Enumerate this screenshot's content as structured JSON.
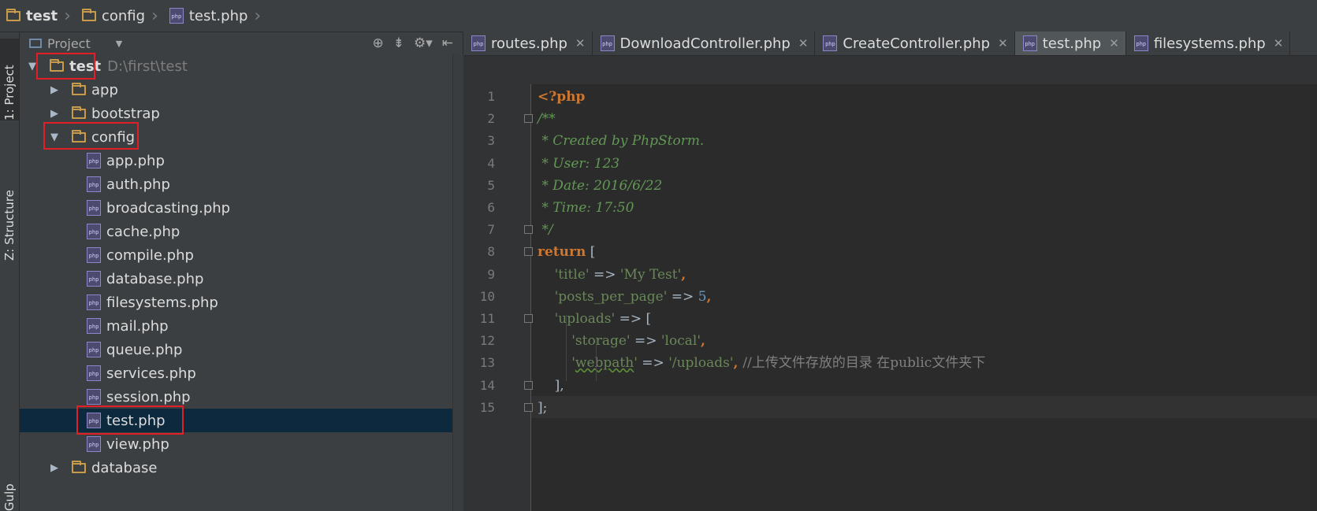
{
  "breadcrumb": [
    {
      "label": "test",
      "icon": "folder-icon"
    },
    {
      "label": "config",
      "icon": "folder-icon"
    },
    {
      "label": "test.php",
      "icon": "php-file-icon"
    }
  ],
  "tool_windows": {
    "project": "1: Project",
    "structure": "Z: Structure",
    "gulp": "Gulp"
  },
  "project_panel": {
    "title": "Project",
    "tools": [
      "⊕",
      "⇟",
      "⚙▾",
      "⇤"
    ]
  },
  "tree": [
    {
      "label": "test",
      "path": "D:\\first\\test",
      "type": "folder",
      "expanded": true
    },
    {
      "label": "app",
      "type": "folder",
      "expanded": false
    },
    {
      "label": "bootstrap",
      "type": "folder",
      "expanded": false
    },
    {
      "label": "config",
      "type": "folder",
      "expanded": true
    },
    {
      "label": "app.php",
      "type": "php"
    },
    {
      "label": "auth.php",
      "type": "php"
    },
    {
      "label": "broadcasting.php",
      "type": "php"
    },
    {
      "label": "cache.php",
      "type": "php"
    },
    {
      "label": "compile.php",
      "type": "php"
    },
    {
      "label": "database.php",
      "type": "php"
    },
    {
      "label": "filesystems.php",
      "type": "php"
    },
    {
      "label": "mail.php",
      "type": "php"
    },
    {
      "label": "queue.php",
      "type": "php"
    },
    {
      "label": "services.php",
      "type": "php"
    },
    {
      "label": "session.php",
      "type": "php"
    },
    {
      "label": "test.php",
      "type": "php",
      "selected": true
    },
    {
      "label": "view.php",
      "type": "php"
    },
    {
      "label": "database",
      "type": "folder",
      "expanded": false
    }
  ],
  "tabs": [
    {
      "label": "routes.php"
    },
    {
      "label": "DownloadController.php"
    },
    {
      "label": "CreateController.php"
    },
    {
      "label": "test.php",
      "active": true
    },
    {
      "label": "filesystems.php"
    }
  ],
  "php_icon_text": "php",
  "close_glyph": "✕",
  "editor": {
    "line_numbers": [
      "1",
      "2",
      "3",
      "4",
      "5",
      "6",
      "7",
      "8",
      "9",
      "10",
      "11",
      "12",
      "13",
      "14",
      "15"
    ],
    "lines": [
      [
        {
          "t": "<?php",
          "c": "kw"
        }
      ],
      [
        {
          "t": "/**",
          "c": "cm"
        }
      ],
      [
        {
          "t": " * Created by PhpStorm.",
          "c": "cm"
        }
      ],
      [
        {
          "t": " * User: 123",
          "c": "cm"
        }
      ],
      [
        {
          "t": " * Date: 2016/6/22",
          "c": "cm"
        }
      ],
      [
        {
          "t": " * Time: 17:50",
          "c": "cm"
        }
      ],
      [
        {
          "t": " */",
          "c": "cm"
        }
      ],
      [
        {
          "t": "return",
          "c": "kw"
        },
        {
          "t": " [",
          "c": ""
        }
      ],
      [
        {
          "t": "    'title'",
          "c": "st"
        },
        {
          "t": " => ",
          "c": ""
        },
        {
          "t": "'My Test'",
          "c": "st"
        },
        {
          "t": ",",
          "c": "kw"
        }
      ],
      [
        {
          "t": "    'posts_per_page'",
          "c": "st"
        },
        {
          "t": " => ",
          "c": ""
        },
        {
          "t": "5",
          "c": "num"
        },
        {
          "t": ",",
          "c": "kw"
        }
      ],
      [
        {
          "t": "    'uploads'",
          "c": "st"
        },
        {
          "t": " => [",
          "c": ""
        }
      ],
      [
        {
          "t": "        'storage'",
          "c": "st"
        },
        {
          "t": " => ",
          "c": ""
        },
        {
          "t": "'local'",
          "c": "st"
        },
        {
          "t": ",",
          "c": "kw"
        }
      ],
      [
        {
          "t": "        '",
          "c": "st"
        },
        {
          "t": "webpath",
          "c": "st wavy"
        },
        {
          "t": "'",
          "c": "st"
        },
        {
          "t": " => ",
          "c": ""
        },
        {
          "t": "'/uploads'",
          "c": "st"
        },
        {
          "t": ", ",
          "c": "kw"
        },
        {
          "t": "//上传文件存放的目录 在public文件夹下",
          "c": "lc"
        }
      ],
      [
        {
          "t": "    ],",
          "c": ""
        }
      ],
      [
        {
          "t": "];",
          "c": ""
        }
      ]
    ]
  },
  "colors": {
    "background": "#2b2b2b",
    "panel": "#3c3f41",
    "keyword": "#cc7832",
    "string": "#6a8759",
    "comment": "#629755",
    "number": "#6897bb",
    "highlight_box": "#e21f27",
    "selection": "#0d293e"
  }
}
